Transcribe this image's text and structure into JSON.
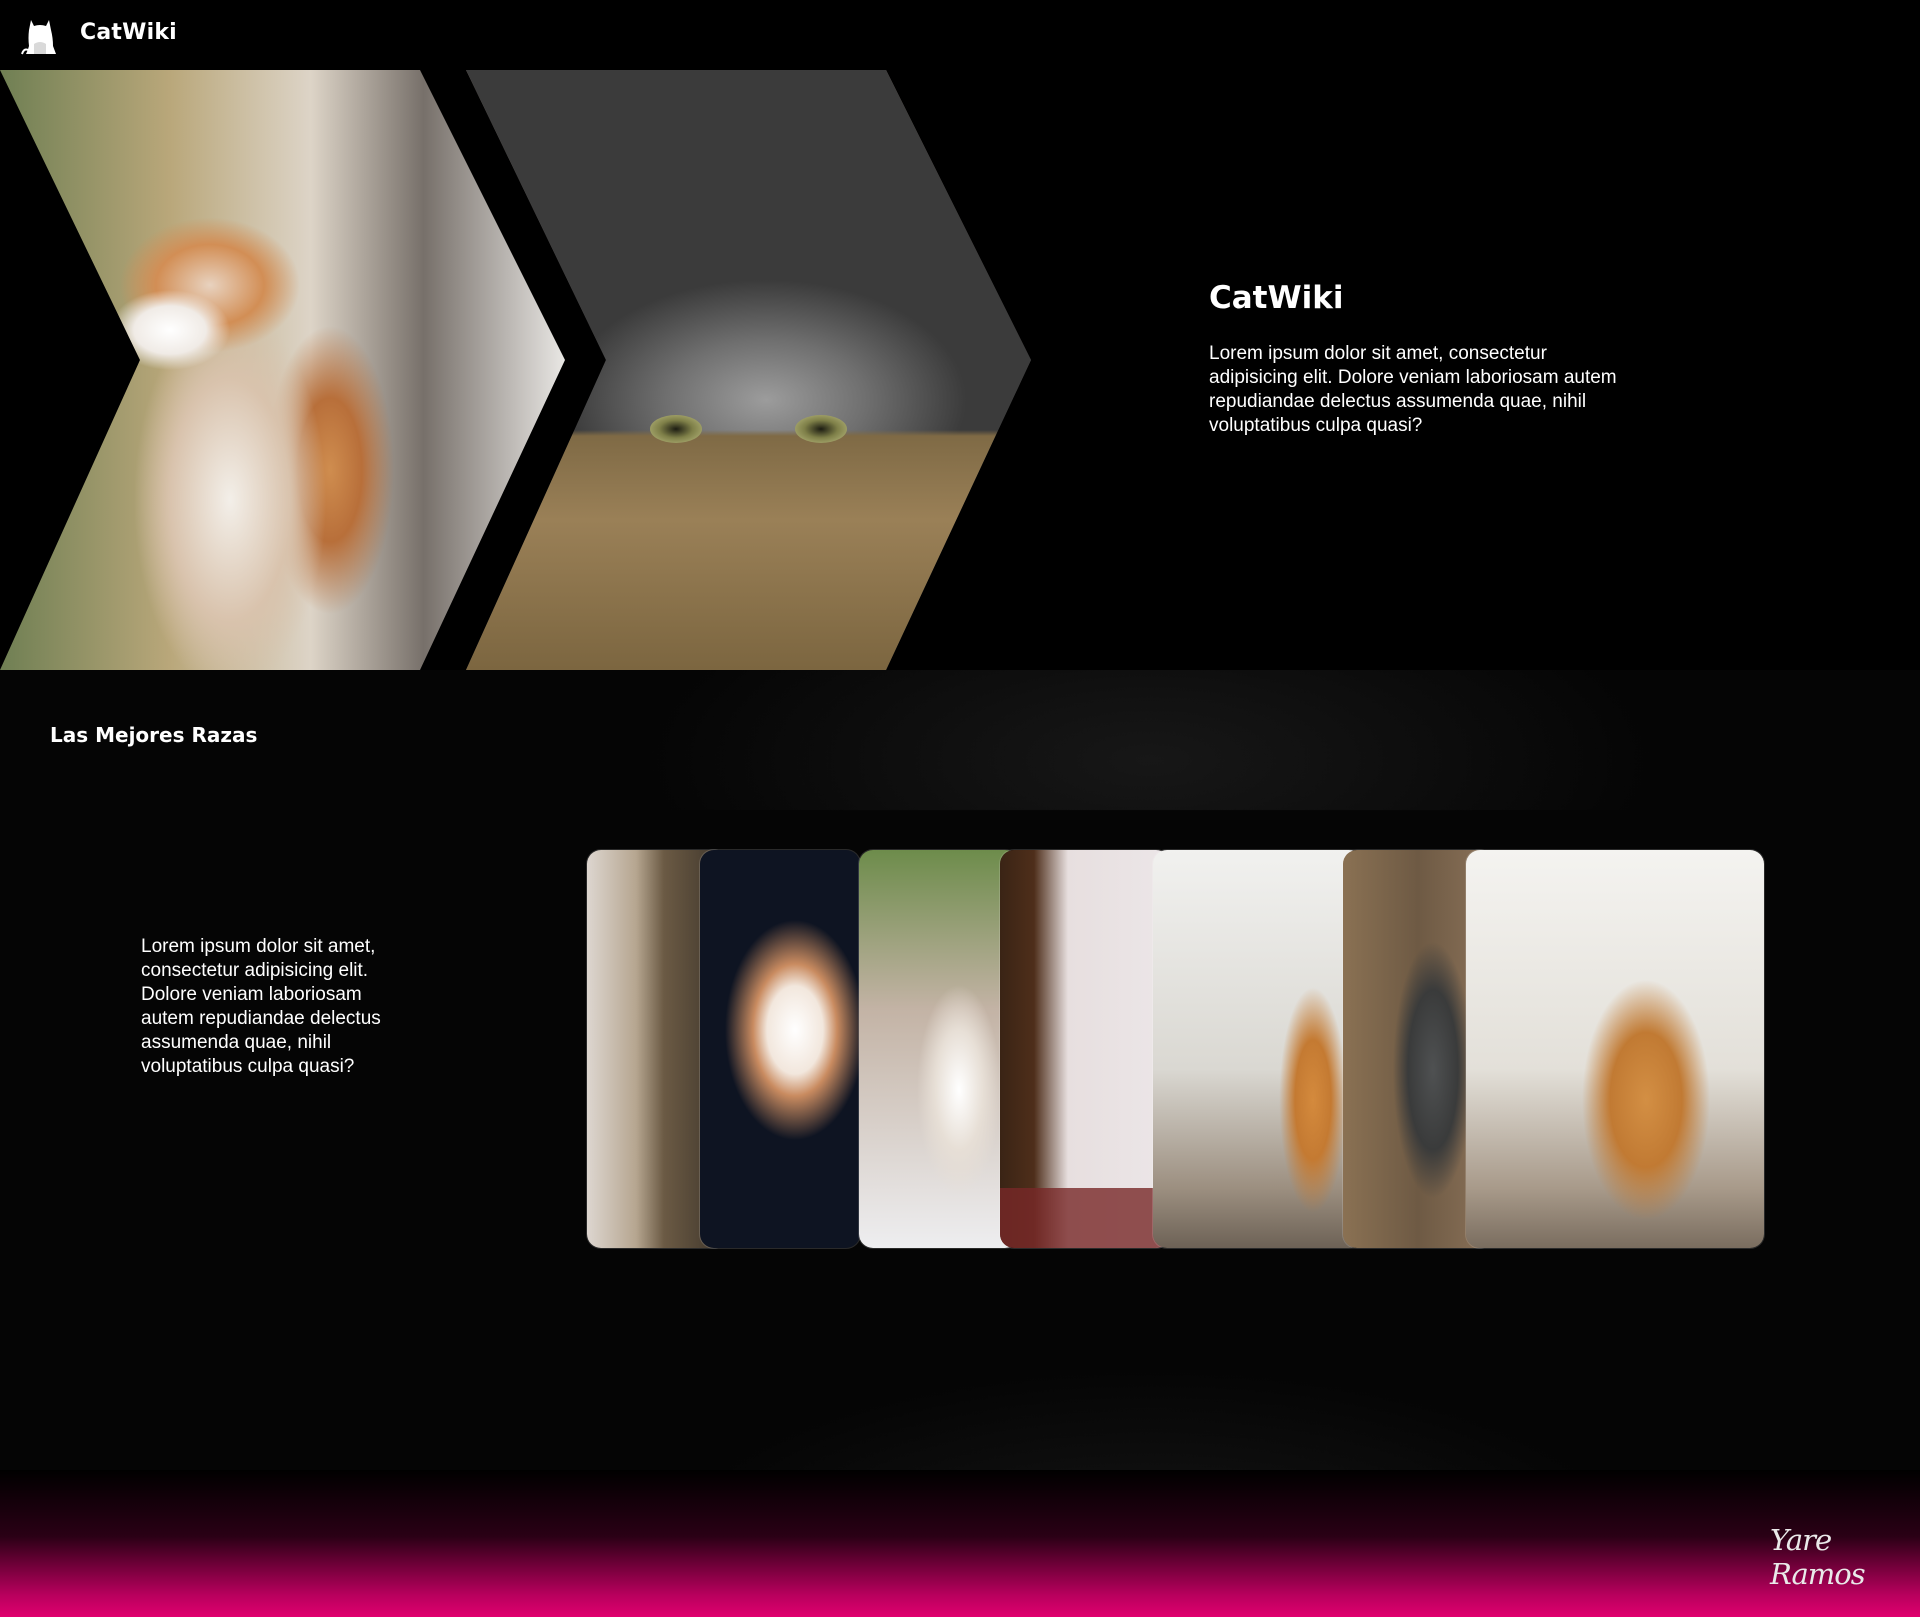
{
  "header": {
    "brand": "CatWiki",
    "logo_icon": "cat-silhouette-icon"
  },
  "hero": {
    "title": "CatWiki",
    "description": "Lorem ipsum dolor sit amet, consectetur adipisicing elit. Dolore veniam laboriosam autem repudiandae delectus assumenda quae, nihil voluptatibus culpa quasi?",
    "images": [
      "orange-white-kitten-photo",
      "tabby-cat-in-box-photo"
    ]
  },
  "breeds": {
    "title": "Las Mejores Razas",
    "description": "Lorem ipsum dolor sit amet, consectetur adipisicing elit. Dolore veniam laboriosam autem repudiandae delectus assumenda quae, nihil voluptatibus culpa quasi?",
    "cards": [
      "tabby-cat-photo",
      "white-kitten-photo",
      "orange-white-cat-photo",
      "cat-peeking-photo",
      "orange-cat-window-photo",
      "gray-cat-photo",
      "orange-tabby-cat-photo"
    ]
  },
  "footer": {
    "signature": "Yare Ramos"
  },
  "colors": {
    "background": "#000000",
    "footer_accent": "#e0006e"
  }
}
